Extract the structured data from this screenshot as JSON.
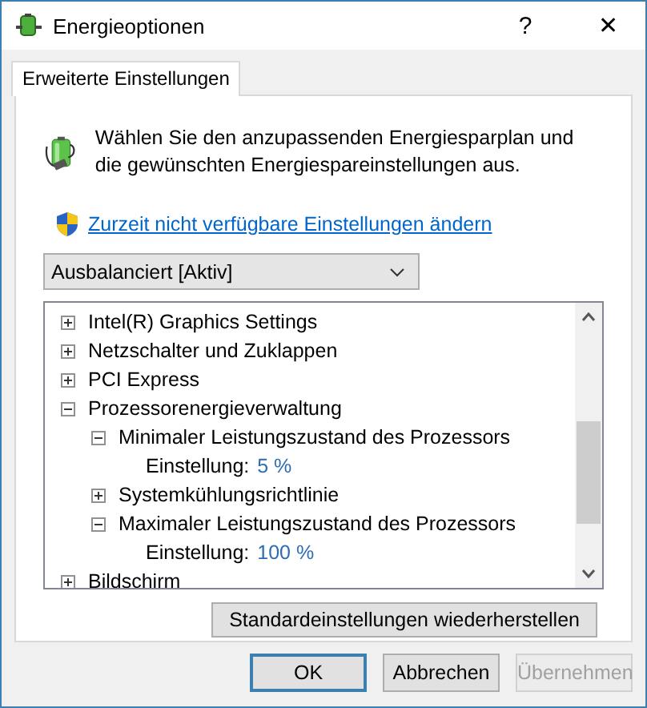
{
  "window": {
    "title": "Energieoptionen",
    "help": "?",
    "close": "✕"
  },
  "tabs": [
    {
      "label": "Erweiterte Einstellungen",
      "selected": true
    }
  ],
  "intro": "Wählen Sie den anzupassenden Energiesparplan und die gewünschten Energiespareinstellungen aus.",
  "admin_link": "Zurzeit nicht verfügbare Einstellungen ändern",
  "plan_select": {
    "value": "Ausbalanciert [Aktiv]"
  },
  "tree": [
    {
      "kind": "group",
      "label": "Intel(R) Graphics Settings",
      "expanded": false
    },
    {
      "kind": "group",
      "label": "Netzschalter und Zuklappen",
      "expanded": false
    },
    {
      "kind": "group",
      "label": "PCI Express",
      "expanded": false
    },
    {
      "kind": "group",
      "label": "Prozessorenergieverwaltung",
      "expanded": true,
      "children": [
        {
          "kind": "group",
          "label": "Minimaler Leistungszustand des Prozessors",
          "expanded": true,
          "children": [
            {
              "kind": "setting",
              "label": "Einstellung:",
              "value": "5 %"
            }
          ]
        },
        {
          "kind": "group",
          "label": "Systemkühlungsrichtlinie",
          "expanded": false
        },
        {
          "kind": "group",
          "label": "Maximaler Leistungszustand des Prozessors",
          "expanded": true,
          "children": [
            {
              "kind": "setting",
              "label": "Einstellung:",
              "value": "100 %"
            }
          ]
        }
      ]
    },
    {
      "kind": "group",
      "label": "Bildschirm",
      "expanded": false
    }
  ],
  "restore_button": "Standardeinstellungen wiederherstellen",
  "buttons": [
    {
      "label": "OK",
      "default": true,
      "disabled": false
    },
    {
      "label": "Abbrechen",
      "default": false,
      "disabled": false
    },
    {
      "label": "Übernehmen",
      "default": false,
      "disabled": true
    }
  ]
}
